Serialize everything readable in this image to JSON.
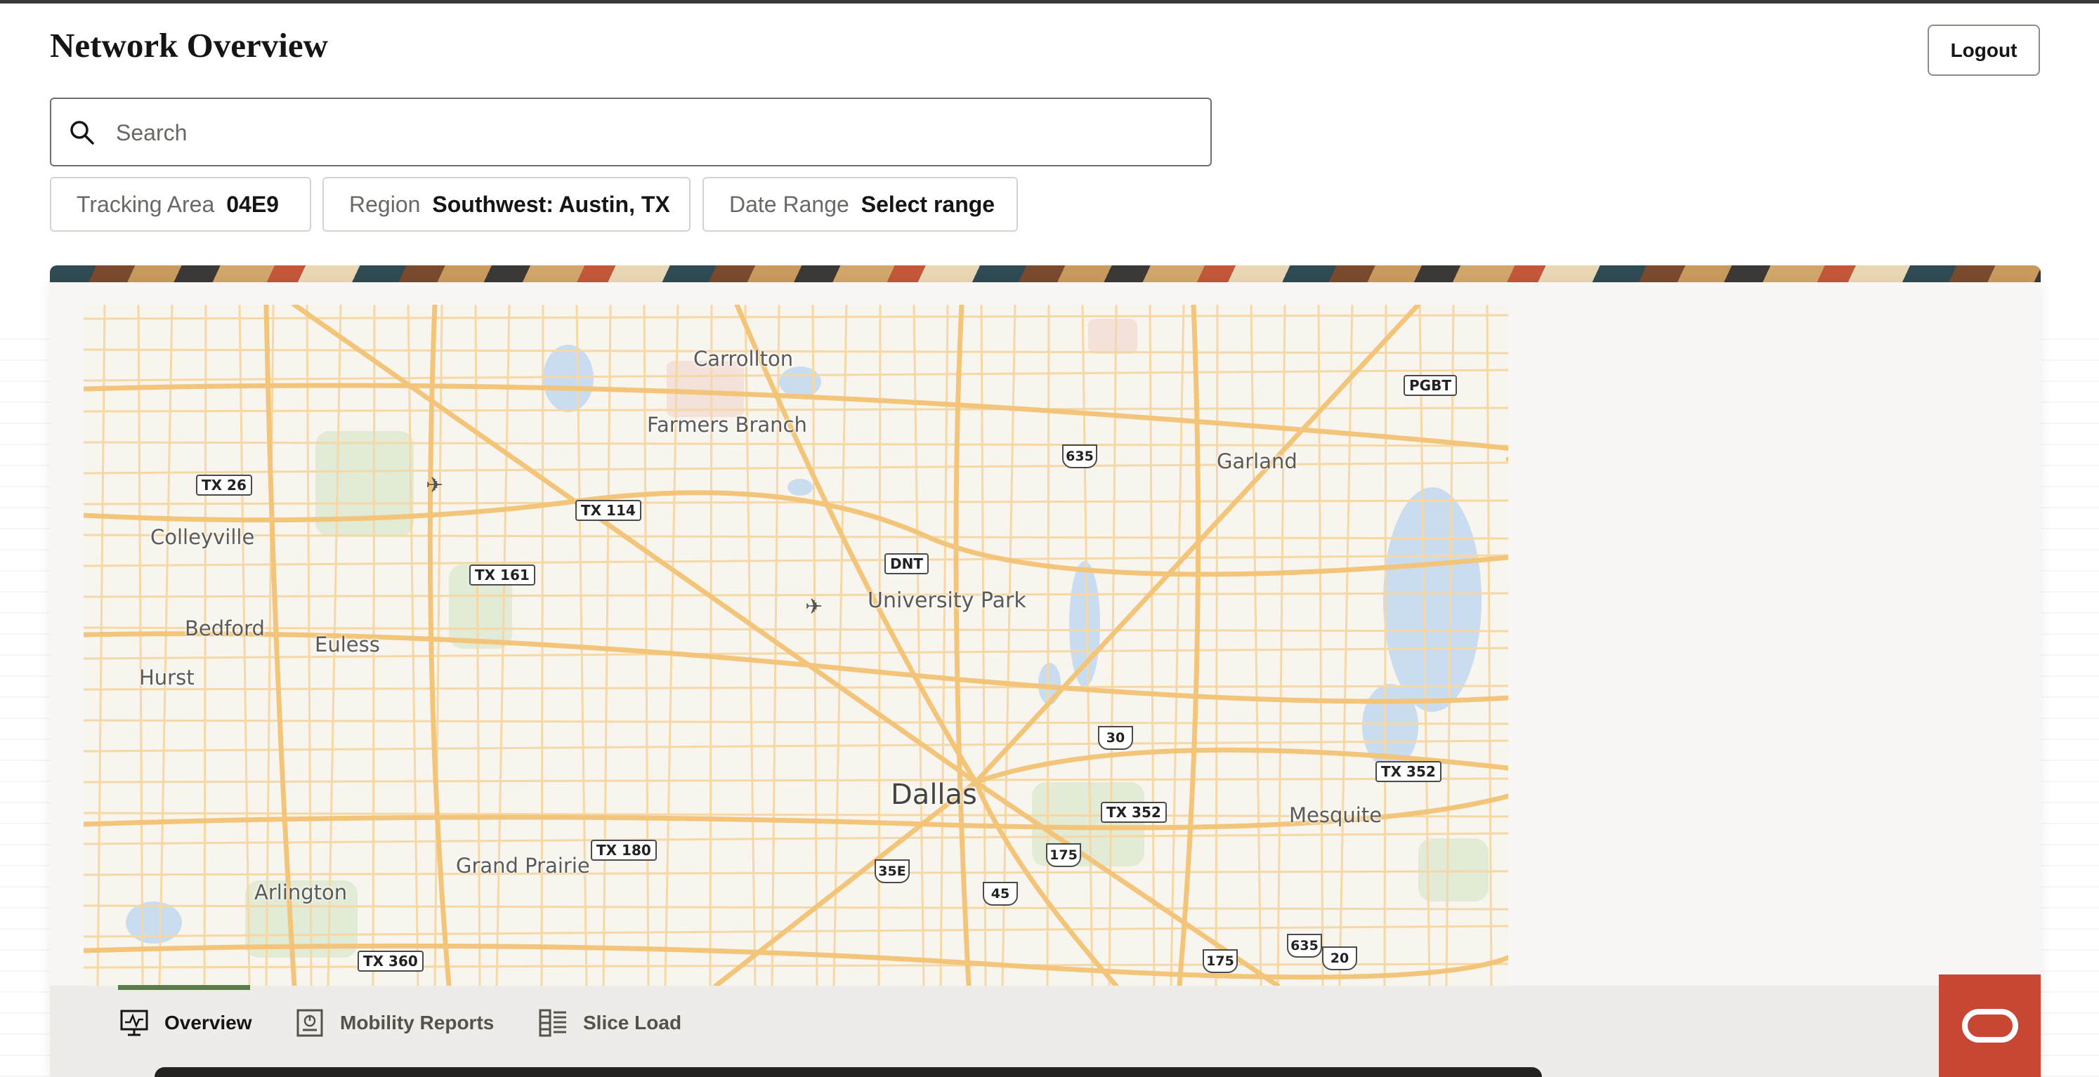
{
  "header": {
    "title": "Network Overview",
    "logout_label": "Logout"
  },
  "search": {
    "placeholder": "Search",
    "value": ""
  },
  "filters": [
    {
      "label": "Tracking Area",
      "value": "04E9"
    },
    {
      "label": "Region",
      "value": "Southwest: Austin, TX"
    },
    {
      "label": "Date Range",
      "value": "Select range"
    }
  ],
  "map": {
    "cities": [
      "Carrollton",
      "Farmers Branch",
      "Garland",
      "Colleyville",
      "Bedford",
      "Euless",
      "Hurst",
      "University Park",
      "Dallas",
      "Mesquite",
      "Grand Prairie",
      "Arlington"
    ],
    "highway_labels": [
      "TX 26",
      "TX 114",
      "TX 161",
      "DNT",
      "PGBT",
      "TX 352",
      "TX 352",
      "TX 180",
      "TX 360"
    ],
    "interstate_labels": [
      "635",
      "30",
      "175",
      "35E",
      "45",
      "175",
      "635",
      "20"
    ]
  },
  "nav": {
    "tabs": [
      {
        "label": "Overview",
        "icon": "monitor-chart-icon",
        "active": true
      },
      {
        "label": "Mobility Reports",
        "icon": "report-icon",
        "active": false
      },
      {
        "label": "Slice Load",
        "icon": "list-grid-icon",
        "active": false
      }
    ]
  },
  "colors": {
    "accent_green": "#5a7c4b",
    "assistant": "#c74634"
  }
}
